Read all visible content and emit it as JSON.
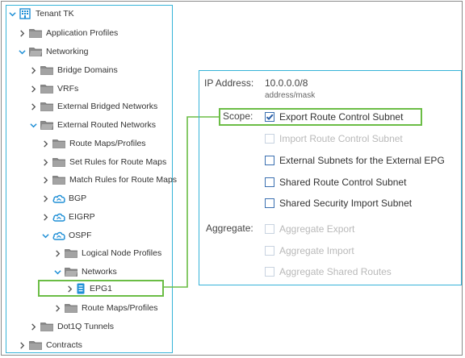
{
  "tree": {
    "tenant_label": "Tenant TK",
    "application_profiles": "Application Profiles",
    "networking": "Networking",
    "bridge_domains": "Bridge Domains",
    "vrfs": "VRFs",
    "external_bridged_networks": "External Bridged Networks",
    "external_routed_networks": "External Routed Networks",
    "route_maps_profiles": "Route Maps/Profiles",
    "set_rules": "Set Rules for Route Maps",
    "match_rules": "Match Rules for Route Maps",
    "bgp": "BGP",
    "eigrp": "EIGRP",
    "ospf": "OSPF",
    "logical_node_profiles": "Logical Node Profiles",
    "networks": "Networks",
    "epg1": "EPG1",
    "ospf_route_maps_profiles": "Route Maps/Profiles",
    "dot1q_tunnels": "Dot1Q Tunnels",
    "contracts": "Contracts"
  },
  "detail": {
    "ip_label": "IP Address:",
    "ip_value": "10.0.0.0/8",
    "ip_hint": "address/mask",
    "scope_label": "Scope:",
    "aggregate_label": "Aggregate:",
    "scope_options": {
      "export_route_control": "Export Route Control Subnet",
      "import_route_control": "Import Route Control Subnet",
      "external_subnets": "External Subnets for the External EPG",
      "shared_route_control": "Shared Route Control Subnet",
      "shared_security_import": "Shared Security Import Subnet"
    },
    "aggregate_options": {
      "aggregate_export": "Aggregate Export",
      "aggregate_import": "Aggregate Import",
      "aggregate_shared_routes": "Aggregate Shared Routes"
    }
  },
  "colors": {
    "panel_border": "#36b3d8",
    "highlight": "#6bbd45",
    "icon_blue": "#1f8fd6",
    "checkbox_border": "#3a6fb0"
  }
}
